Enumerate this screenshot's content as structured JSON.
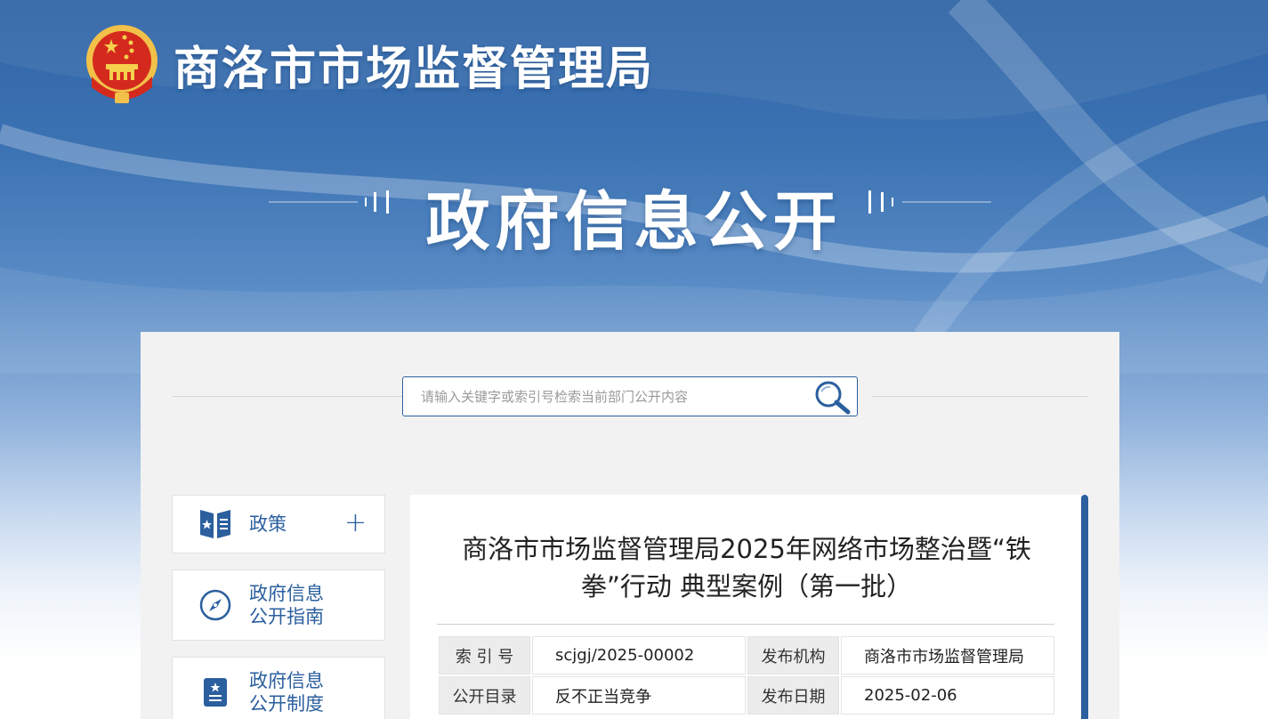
{
  "header": {
    "site_title": "商洛市市场监督管理局",
    "emblem_icon": "national-emblem-icon"
  },
  "banner": {
    "title": "政府信息公开"
  },
  "search": {
    "placeholder": "请输入关键字或索引号检索当前部门公开内容",
    "icon": "search-icon"
  },
  "sidebar": {
    "items": [
      {
        "label": "政策",
        "icon": "policy-book-icon",
        "expandable": true
      },
      {
        "label": "政府信息\n公开指南",
        "icon": "compass-icon",
        "expandable": false
      },
      {
        "label": "政府信息\n公开制度",
        "icon": "regulation-doc-icon",
        "expandable": false
      }
    ]
  },
  "article": {
    "title": "商洛市市场监督管理局2025年网络市场整治暨“铁拳”行动 典型案例（第一批）",
    "meta": {
      "index_label": "索 引 号",
      "index_value": "scjgj/2025-00002",
      "publisher_label": "发布机构",
      "publisher_value": "商洛市市场监督管理局",
      "catalog_label": "公开目录",
      "catalog_value": "反不正当竞争",
      "date_label": "发布日期",
      "date_value": "2025-02-06"
    }
  },
  "colors": {
    "accent": "#2b5f9e",
    "panel_bg": "#f2f2f2",
    "banner_top": "#2f64a6"
  }
}
